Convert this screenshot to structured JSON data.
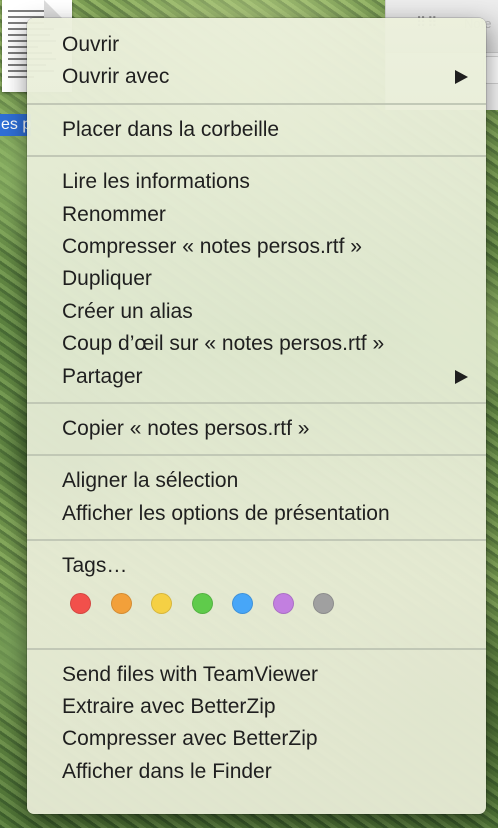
{
  "desktop": {
    "icon_label": "es p"
  },
  "finder_window": {
    "title_fragment": "Note"
  },
  "context_menu": {
    "groups": [
      {
        "items": [
          {
            "label": "Ouvrir",
            "has_submenu": false
          },
          {
            "label": "Ouvrir avec",
            "has_submenu": true
          }
        ]
      },
      {
        "items": [
          {
            "label": "Placer dans la corbeille",
            "has_submenu": false
          }
        ]
      },
      {
        "items": [
          {
            "label": "Lire les informations",
            "has_submenu": false
          },
          {
            "label": "Renommer",
            "has_submenu": false
          },
          {
            "label": "Compresser « notes persos.rtf »",
            "has_submenu": false
          },
          {
            "label": "Dupliquer",
            "has_submenu": false
          },
          {
            "label": "Créer un alias",
            "has_submenu": false
          },
          {
            "label": "Coup d’œil sur « notes persos.rtf »",
            "has_submenu": false
          },
          {
            "label": "Partager",
            "has_submenu": true
          }
        ]
      },
      {
        "items": [
          {
            "label": "Copier « notes persos.rtf »",
            "has_submenu": false
          }
        ]
      },
      {
        "items": [
          {
            "label": "Aligner la sélection",
            "has_submenu": false
          },
          {
            "label": "Afficher les options de présentation",
            "has_submenu": false
          }
        ]
      },
      {
        "items": [
          {
            "label": "Tags…",
            "has_submenu": false
          }
        ],
        "tags": [
          {
            "name": "red",
            "color": "#f2504b"
          },
          {
            "name": "orange",
            "color": "#f2a03a"
          },
          {
            "name": "yellow",
            "color": "#f5d044"
          },
          {
            "name": "green",
            "color": "#5fcb4b"
          },
          {
            "name": "blue",
            "color": "#47a6f8"
          },
          {
            "name": "purple",
            "color": "#c27fe0"
          },
          {
            "name": "gray",
            "color": "#a0a0a0"
          }
        ]
      },
      {
        "items": [
          {
            "label": "Send files with TeamViewer",
            "has_submenu": false
          },
          {
            "label": "Extraire avec BetterZip",
            "has_submenu": false
          },
          {
            "label": "Compresser avec BetterZip",
            "has_submenu": false
          },
          {
            "label": "Afficher dans le Finder",
            "has_submenu": false
          }
        ]
      }
    ]
  }
}
